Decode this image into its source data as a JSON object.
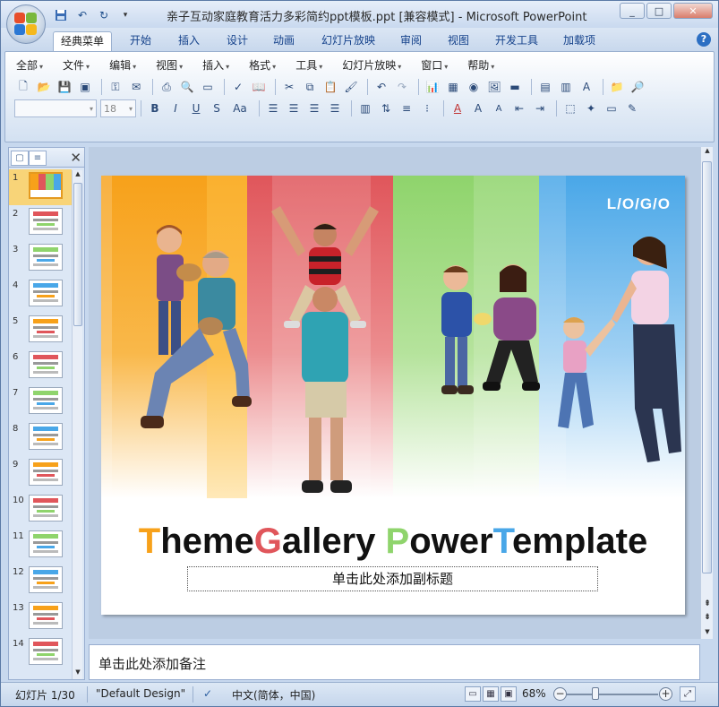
{
  "window": {
    "title": "亲子互动家庭教育活力多彩简约ppt模板.ppt [兼容模式] - Microsoft PowerPoint",
    "controls": [
      "_",
      "□",
      "✕"
    ]
  },
  "ribbon_tabs": [
    {
      "label": "经典菜单",
      "active": true
    },
    {
      "label": "开始"
    },
    {
      "label": "插入"
    },
    {
      "label": "设计"
    },
    {
      "label": "动画"
    },
    {
      "label": "幻灯片放映"
    },
    {
      "label": "审阅"
    },
    {
      "label": "视图"
    },
    {
      "label": "开发工具"
    },
    {
      "label": "加载项"
    }
  ],
  "menu": [
    "全部",
    "文件",
    "编辑",
    "视图",
    "插入",
    "格式",
    "工具",
    "幻灯片放映",
    "窗口",
    "帮助"
  ],
  "toolbar": {
    "font_size": "18"
  },
  "slides_panel": {
    "numbers": [
      "1",
      "2",
      "3",
      "4",
      "5",
      "6",
      "7",
      "8",
      "9",
      "10",
      "11",
      "12",
      "13",
      "14"
    ],
    "selected": 1
  },
  "slide": {
    "logo": "L/O/G/O",
    "title_parts": [
      {
        "text": "T",
        "color": "#f7a11a"
      },
      {
        "text": "heme",
        "color": "#111111"
      },
      {
        "text": "G",
        "color": "#e0565b"
      },
      {
        "text": "allery ",
        "color": "#111111"
      },
      {
        "text": "P",
        "color": "#8fd46c"
      },
      {
        "text": "ower",
        "color": "#111111"
      },
      {
        "text": "T",
        "color": "#49a7e8"
      },
      {
        "text": "emplate",
        "color": "#111111"
      }
    ],
    "subtitle": "单击此处添加副标题",
    "band_colors": [
      "#f7a11a",
      "#e0565b",
      "#8fd46c",
      "#49a7e8"
    ]
  },
  "notes": {
    "text": "单击此处添加备注"
  },
  "status": {
    "slide_indicator": "幻灯片 1/30",
    "design": "\"Default Design\"",
    "language": "中文(简体，中国)",
    "zoom": "68%"
  }
}
